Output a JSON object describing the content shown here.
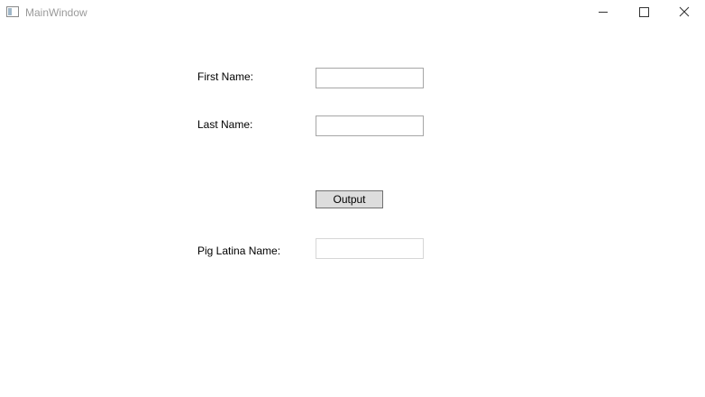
{
  "window": {
    "title": "MainWindow",
    "icon": "app-window-icon",
    "controls": {
      "minimize_icon": "minimize-icon",
      "maximize_icon": "maximize-icon",
      "close_icon": "close-icon"
    }
  },
  "form": {
    "first_name_label": "First Name:",
    "first_name_value": "",
    "last_name_label": "Last Name:",
    "last_name_value": "",
    "output_button_label": "Output",
    "pig_latin_label": "Pig Latina Name:",
    "pig_latin_value": ""
  },
  "colors": {
    "title_text": "#9a9a9a",
    "textbox_border": "#a6a6a6",
    "readonly_border": "#d6d6d6",
    "button_bg": "#dddddd",
    "button_border": "#707070"
  }
}
